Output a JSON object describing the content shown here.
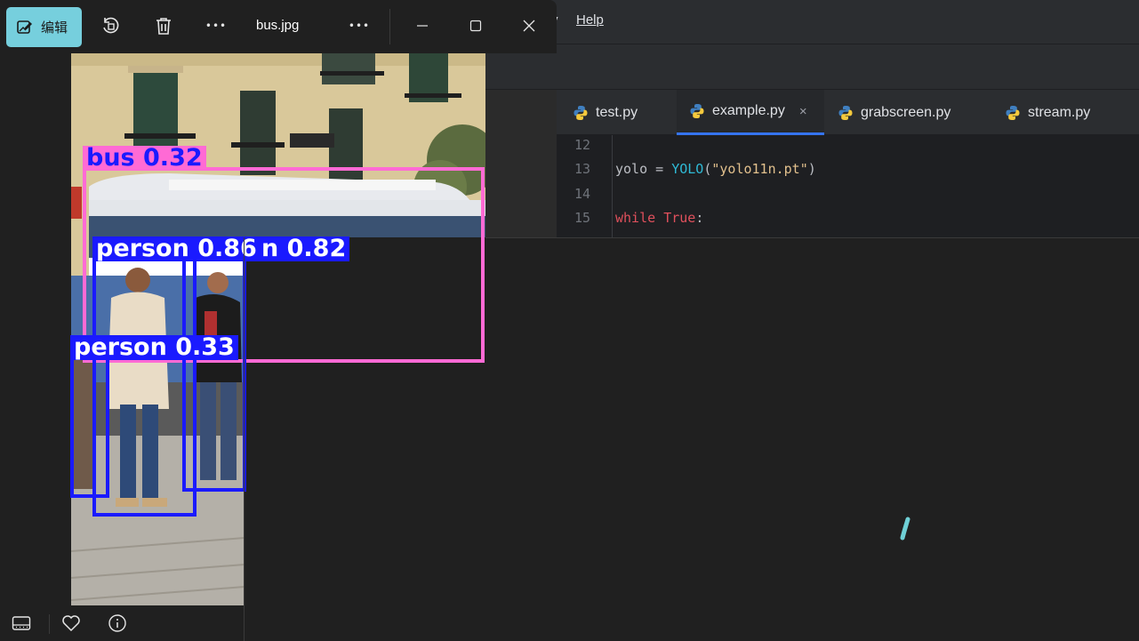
{
  "ide": {
    "menu": {
      "help": "Help",
      "partial_item": "v"
    },
    "tabs": [
      {
        "label": "test.py"
      },
      {
        "label": "example.py",
        "close": "×"
      },
      {
        "label": "grabscreen.py"
      },
      {
        "label": "stream.py"
      }
    ],
    "code": {
      "line_numbers": [
        "12",
        "13",
        "14",
        "15"
      ],
      "line13": {
        "pre": "yolo = ",
        "cls": "YOLO",
        "open": "(",
        "str": "\"yolo11n.pt\"",
        "close": ")"
      },
      "line15": {
        "kw1": "while",
        "space": " ",
        "kw2": "True",
        "colon": ":"
      }
    }
  },
  "viewer": {
    "edit_label": "编辑",
    "file_name": "bus.jpg",
    "more_label": "•••"
  },
  "detections": [
    {
      "label": "bus 0.32",
      "color": "#ff6ad5"
    },
    {
      "label": "person 0.86",
      "color": "#1a1aff"
    },
    {
      "label": "n 0.82",
      "color": "#1a1aff"
    },
    {
      "label": "person 0.33",
      "color": "#1a1aff"
    }
  ],
  "colors": {
    "accent": "#76cfdd",
    "bus_box": "#ff6ad5",
    "person_box": "#1a1aff"
  }
}
